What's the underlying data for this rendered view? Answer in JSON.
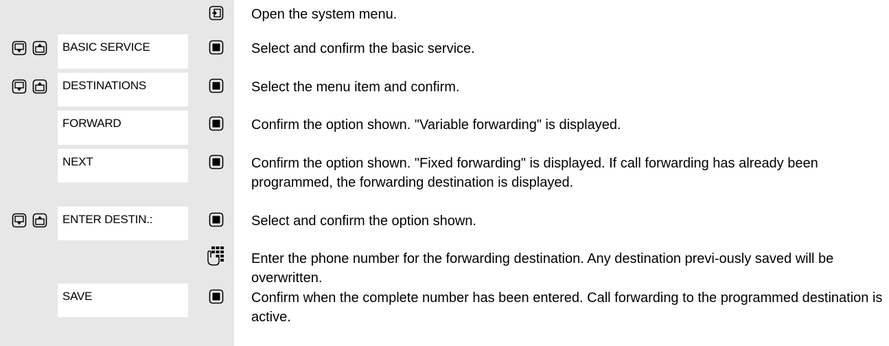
{
  "steps": [
    {
      "label": "",
      "nav": false,
      "button": "menu",
      "text": "Open the system menu."
    },
    {
      "label": "BASIC SERVICE",
      "nav": true,
      "button": "ok",
      "text": "Select and confirm the basic service."
    },
    {
      "label": "DESTINATIONS",
      "nav": true,
      "button": "ok",
      "text": "Select the menu item and confirm."
    },
    {
      "label": "FORWARD",
      "nav": false,
      "button": "ok",
      "text": "Confirm the option shown. \"Variable forwarding\" is displayed."
    },
    {
      "label": "NEXT",
      "nav": false,
      "button": "ok",
      "text": "Confirm the option shown. \"Fixed forwarding\" is displayed. If call forwarding has already been programmed, the forwarding destination is displayed."
    },
    {
      "label": "ENTER DESTIN.:",
      "nav": true,
      "button": "ok",
      "text": "Select and confirm the option shown."
    },
    {
      "label": "",
      "nav": false,
      "button": "keypad",
      "text": "Enter the phone number for the forwarding destination. Any destination previ-ously saved will be overwritten."
    },
    {
      "label": "SAVE",
      "nav": false,
      "button": "ok",
      "text": "Confirm when the complete number has been entered. Call forwarding to the programmed destination is active."
    }
  ]
}
